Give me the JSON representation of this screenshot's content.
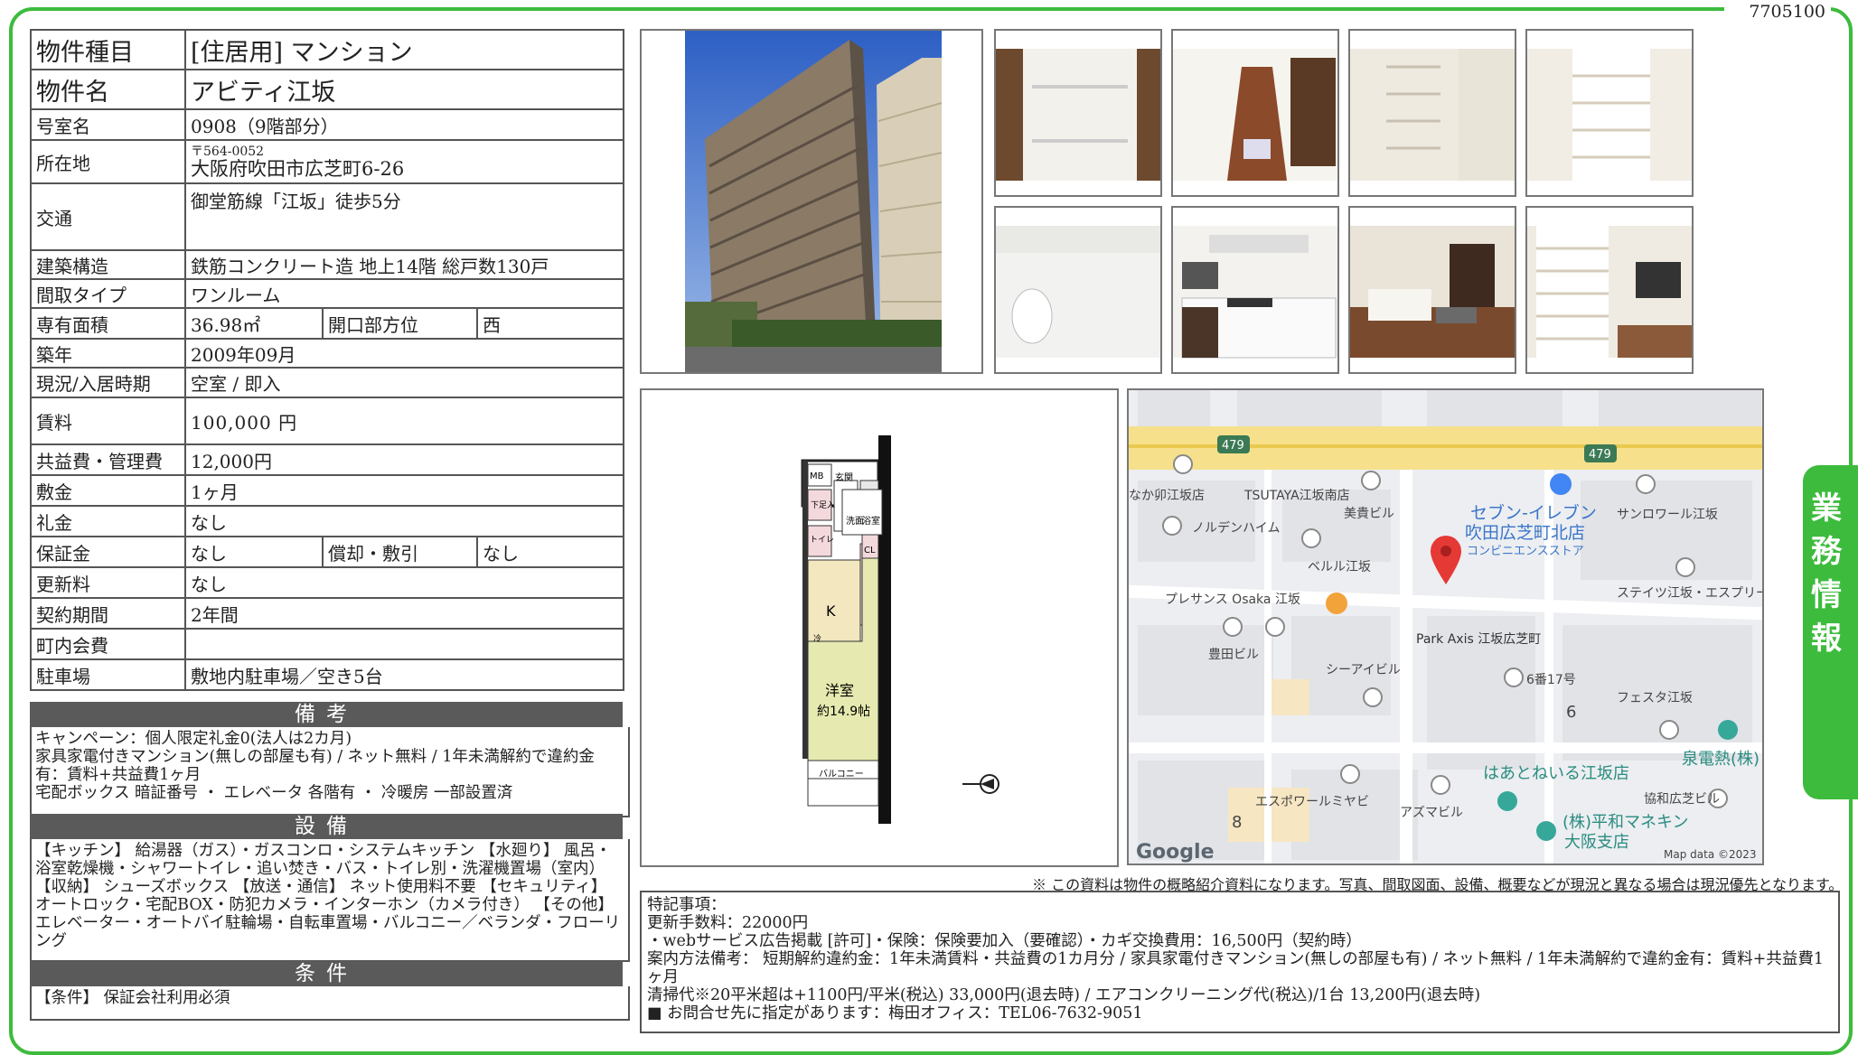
{
  "doc_number": "7705100",
  "side_tab": [
    "業",
    "務",
    "情",
    "報"
  ],
  "info": {
    "type_label": "物件種目",
    "type_value": "[住居用] マンション",
    "name_label": "物件名",
    "name_value": "アビティ江坂",
    "room_label": "号室名",
    "room_value": "0908（9階部分）",
    "address_label": "所在地",
    "postal": "〒564-0052",
    "address": "大阪府吹田市広芝町6-26",
    "access_label": "交通",
    "access_value": "御堂筋線「江坂」徒歩5分",
    "structure_label": "建築構造",
    "structure_value": "鉄筋コンクリート造 地上14階 総戸数130戸",
    "layout_label": "間取タイプ",
    "layout_value": "ワンルーム",
    "area_label": "専有面積",
    "area_value": "36.98㎡",
    "facing_label": "開口部方位",
    "facing_value": "西",
    "built_label": "築年",
    "built_value": "2009年09月",
    "status_label": "現況/入居時期",
    "status_value": "空室 / 即入",
    "rent_label": "賃料",
    "rent_value": "100,000 円",
    "fee_label": "共益費・管理費",
    "fee_value": "12,000円",
    "deposit_label": "敷金",
    "deposit_value": "1ヶ月",
    "keymoney_label": "礼金",
    "keymoney_value": "なし",
    "guarantee_label": "保証金",
    "guarantee_value": "なし",
    "amort_label": "償却・敷引",
    "amort_value": "なし",
    "renewal_label": "更新料",
    "renewal_value": "なし",
    "term_label": "契約期間",
    "term_value": "2年間",
    "town_label": "町内会費",
    "town_value": "",
    "parking_label": "駐車場",
    "parking_value": "敷地内駐車場／空き5台"
  },
  "remarks_section": {
    "title": "備考",
    "lines": [
      "キャンペーン：個人限定礼金0(法人は2カ月)",
      "家具家電付きマンション(無しの部屋も有) / ネット無料 / 1年未満解約で違約金有：賃料+共益費1ヶ月",
      "宅配ボックス 暗証番号 ・ エレベータ 各階有 ・ 冷暖房 一部設置済"
    ]
  },
  "facilities_section": {
    "title": "設備",
    "text": "【キッチン】 給湯器（ガス）・ガスコンロ・システムキッチン 【水廻り】 風呂・浴室乾燥機・シャワートイレ・追い焚き・バス・トイレ別・洗濯機置場（室内） 【収納】 シューズボックス 【放送・通信】 ネット使用料不要 【セキュリティ】 オートロック・宅配BOX・防犯カメラ・インターホン（カメラ付き） 【その他】 エレベーター・オートバイ駐輪場・自転車置場・バルコニー／ベランダ・フローリング"
  },
  "conditions_section": {
    "title": "条件",
    "text": "【条件】 保証会社利用必須"
  },
  "floorplan": {
    "room_name": "洋室",
    "room_size": "約14.9帖",
    "kitchen": "K",
    "balcony": "バルコニー",
    "mb": "MB",
    "entrance": "玄関",
    "shoes": "下足入",
    "toilet": "トイレ",
    "washroom": "洗面",
    "bath": "浴室",
    "closet": "CL",
    "fridge": "冷"
  },
  "map": {
    "route_badges": [
      "479",
      "479"
    ],
    "labels": [
      "なか卯江坂店",
      "TSUTAYA江坂南店",
      "美貴ビル",
      "ノルデンハイム",
      "ベルル江坂",
      "サンロワール江坂",
      "プレサンス Osaka 江坂",
      "豊田ビル",
      "シーアイビル",
      "ステイツ江坂・エスプリート",
      "6番17号",
      "フェスタ江坂",
      "エスポワールミヤビ",
      "アズマビル",
      "協和広芝ビル",
      "6",
      "8"
    ],
    "store_name": "セブン-イレブン",
    "store_branch": "吹田広芝町北店",
    "store_type": "コンビニエンスストア",
    "target": "Park Axis 江坂広芝町",
    "bakery": "はあとねいる江坂店",
    "electric": "泉電熱(株)",
    "company_1": "(株)平和マネキン",
    "company_2": "大阪支店",
    "google": "Google",
    "mapdata": "Map data ©2023"
  },
  "disclaimer": "※ この資料は物件の概略紹介資料になります。写真、間取図面、設備、概要などが現況と異なる場合は現況優先となります。",
  "special_notes": {
    "heading": "特記事項：",
    "lines": [
      "更新手数料：22000円",
      "・webサービス広告掲載 [許可]・保険：保険要加入（要確認）・カギ交換費用：16,500円（契約時）",
      "案内方法備考： 短期解約違約金：1年未満賃料・共益費の1カ月分 / 家具家電付きマンション(無しの部屋も有) / ネット無料 / 1年未満解約で違約金有：賃料+共益費1ヶ月",
      "清掃代※20平米超は+1100円/平米(税込) 33,000円(退去時) / エアコンクリーニング代(税込)/1台 13,200円(退去時)",
      "■ お問合せ先に指定があります：梅田オフィス：TEL06-7632-9051"
    ]
  },
  "colors": {
    "frame": "#3dbb3d",
    "section_bar": "#5a5a5a",
    "map_road": "#f5df88"
  }
}
